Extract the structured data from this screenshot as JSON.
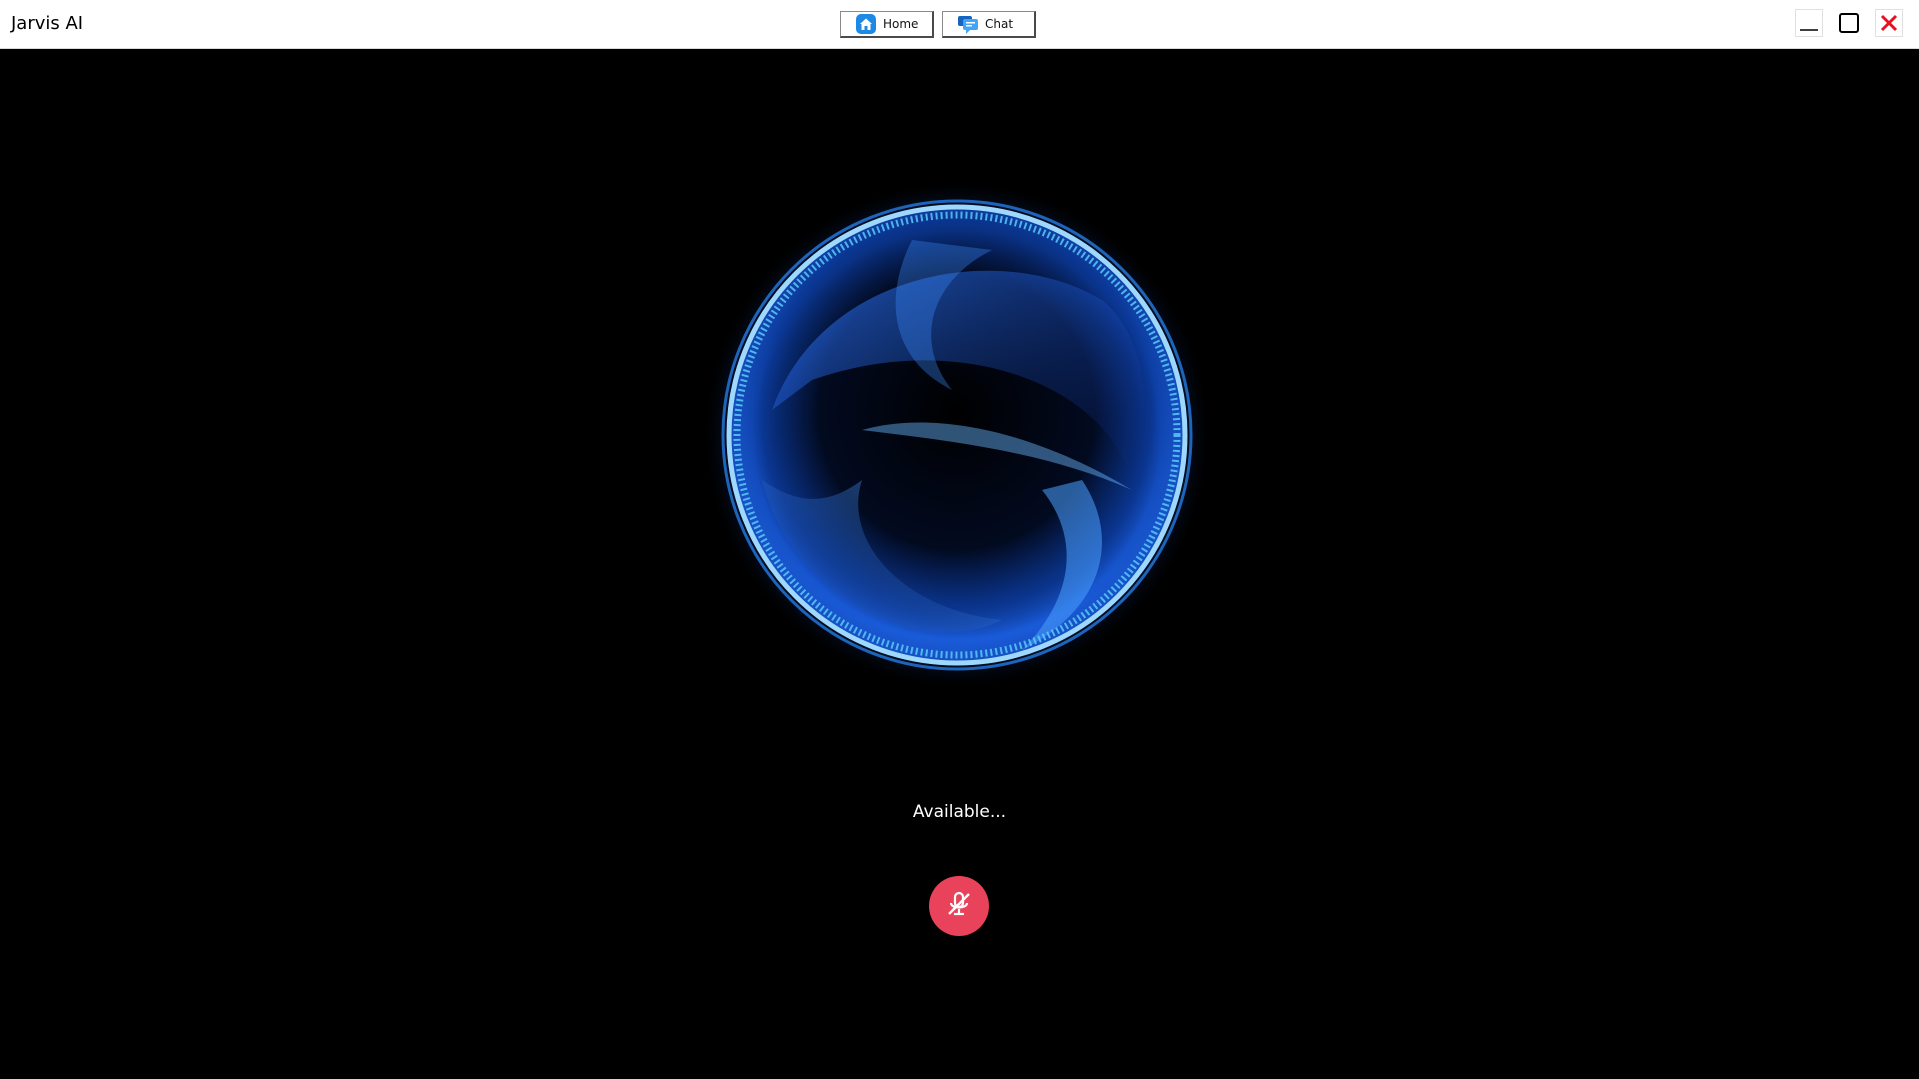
{
  "window": {
    "title": "Jarvis AI",
    "controls": {
      "minimize": "minimize-icon",
      "maximize": "maximize-icon",
      "close": "close-icon"
    }
  },
  "nav": {
    "home_label": "Home",
    "chat_label": "Chat",
    "home_icon": "home-icon",
    "chat_icon": "chat-icon"
  },
  "main": {
    "status_text": "Available...",
    "mic_button_icon": "mic-muted-icon"
  },
  "colors": {
    "orb_glow": "#1e6bff",
    "orb_ring": "#9ed8ff",
    "mic_button": "#e8435a",
    "close_icon": "#e81123",
    "nav_icon": "#1e88e5"
  }
}
